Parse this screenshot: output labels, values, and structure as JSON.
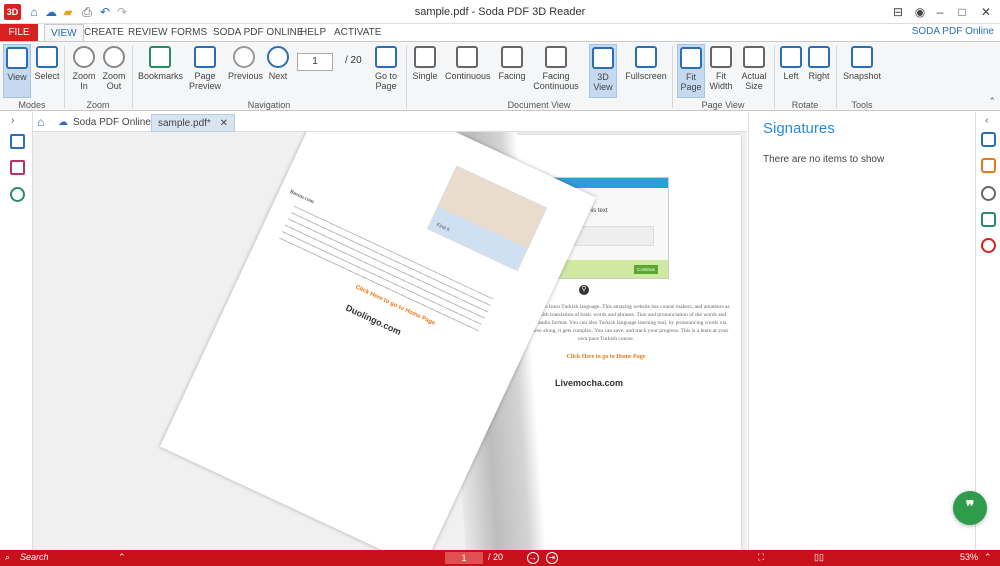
{
  "app": {
    "logo": "3D",
    "title": "sample.pdf  -  Soda PDF 3D Reader",
    "soda_online_link": "SODA PDF Online"
  },
  "ribbon_tabs": [
    "FILE",
    "VIEW",
    "CREATE",
    "REVIEW",
    "FORMS",
    "SODA PDF ONLINE",
    "HELP",
    "ACTIVATE"
  ],
  "ribbon": {
    "buttons": [
      {
        "label": "View"
      },
      {
        "label": "Select"
      },
      {
        "label": "Zoom\nIn"
      },
      {
        "label": "Zoom\nOut"
      },
      {
        "label": "Bookmarks"
      },
      {
        "label": "Page\nPreview"
      },
      {
        "label": "Previous"
      },
      {
        "label": "Next"
      },
      {
        "label": "Go to\nPage"
      },
      {
        "label": "Single"
      },
      {
        "label": "Continuous"
      },
      {
        "label": "Facing"
      },
      {
        "label": "Facing\nContinuous"
      },
      {
        "label": "3D\nView"
      },
      {
        "label": "Fullscreen"
      },
      {
        "label": "Fit\nPage"
      },
      {
        "label": "Fit\nWidth"
      },
      {
        "label": "Actual\nSize"
      },
      {
        "label": "Left"
      },
      {
        "label": "Right"
      },
      {
        "label": "Snapshot"
      }
    ],
    "groups": [
      "Modes",
      "Zoom",
      "Navigation",
      "Document View",
      "Page View",
      "Rotate",
      "Tools"
    ],
    "page_input": "1",
    "page_total": "/ 20"
  },
  "doc_tabs": [
    "Soda PDF Online",
    "sample.pdf*"
  ],
  "document": {
    "left_page": {
      "brand": "Busuu.com",
      "link": "Click Here to go to Home Page",
      "site": "Duolingo.com",
      "caption": "Find it"
    },
    "right_page": {
      "screenshot_title": "Translate this text",
      "para": "offers free language course to learn Turkish language. This amazing website has course makers, and amateurs as well. The module starts with translation of basic words and phrases. Tion and pronunciation of the words and phrases are provided in audio format. You can also Turkish language learning tool, by pronouncing words via microphone. As you move along, it gets complex. You can save, and track your progress. This is a learn at your own pace Turkish course.",
      "link": "Click Here to go to Home Page",
      "site": "Livemocha.com",
      "continue": "Continue"
    }
  },
  "signatures": {
    "title": "Signatures",
    "empty": "There are no items to show"
  },
  "statusbar": {
    "search": "Search",
    "page": "1",
    "of": "/ 20",
    "zoom": "53%"
  },
  "chat": {
    "glyph": "❞"
  }
}
